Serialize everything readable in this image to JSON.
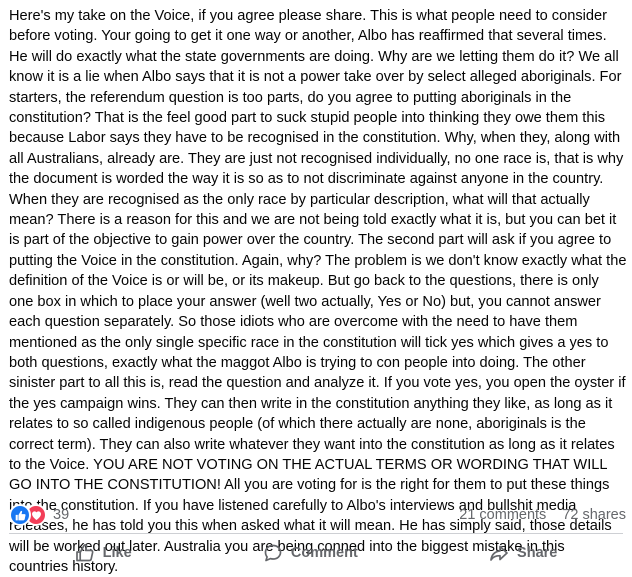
{
  "post": {
    "text": "Here's my take on the Voice, if you agree please share.  This is what people need to consider before voting.  Your going to get it one way or another, Albo has reaffirmed that several times.  He will do exactly what the state governments are doing.  Why are we letting them do it?  We all know it is a lie when Albo says that it is not a power take over by select alleged aboriginals.  For starters, the referendum question is too parts, do you agree to putting aboriginals in the constitution?  That is the feel good part to suck stupid people into thinking they owe them this because Labor says they have to be recognised in the constitution.  Why, when they, along with all Australians, already are.  They are just not recognised individually, no one race is, that is why the document is worded the way it is so as to not discriminate against anyone in the country. When they are recognised as the only race by particular description, what will that actually mean? There is a reason for this and we are not being told exactly what it is, but you can bet it is part of the objective to gain power over the country.  The second part will ask if you agree to putting the Voice in the constitution.  Again, why?  The problem is we don't know exactly what the definition of the Voice is or will be, or its makeup.  But go back to the questions, there is only one box in which to place your answer (well two actually, Yes or No) but, you cannot answer each question separately.  So those idiots who are overcome with the need to have them mentioned as the only single specific race in the constitution will tick yes which gives a yes to both questions, exactly what the maggot Albo is trying to con people into doing.  The other sinister part to all this is, read the question and analyze it.  If you vote yes, you open the oyster if the yes campaign wins.  They can then write in the constitution anything they like, as long as it relates to so called indigenous people (of which there actually are none, aboriginals is the correct term).  They can also write whatever they want into the constitution as long as it relates to the Voice.  YOU ARE NOT VOTING ON THE ACTUAL TERMS OR WORDING THAT WILL GO INTO THE CONSTITUTION!  All you are voting for is the right for them to put these things into the constitution.  If you have listened carefully to Albo's interviews and bullshit media releases, he has told you this when asked what it will mean.  He has simply said, those details will be worked out later.  Australia you are being conned into the biggest mistake in this countries history."
  },
  "stats": {
    "reaction_count": "39",
    "comments": "21 comments",
    "shares": "72 shares"
  },
  "actions": {
    "like": "Like",
    "comment": "Comment",
    "share": "Share"
  },
  "colors": {
    "like_blue": "#1877f2",
    "love_red": "#f33e58",
    "secondary_text": "#65676b",
    "divider": "#ced0d4"
  },
  "icons": {
    "like_reaction": "thumbs-up-icon",
    "love_reaction": "heart-icon",
    "like_action": "thumbs-up-outline-icon",
    "comment_action": "speech-bubble-icon",
    "share_action": "share-arrow-icon"
  }
}
